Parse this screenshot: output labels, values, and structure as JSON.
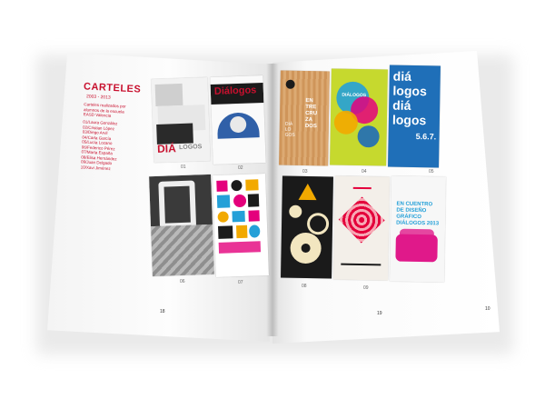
{
  "spread": {
    "left": {
      "title": "CARTELES",
      "years": "2003 - 2013",
      "description": [
        "Carteles realizados por",
        "alumnos de la escuela",
        "EASD Valencia"
      ],
      "credits": [
        "01/Laura González",
        "02/Cristian López",
        "03/Diego Arvil",
        "04/Carla García",
        "05/Lucía Lozano",
        "06/Federico Pérez",
        "07/Marta España",
        "08/Elisa Hernández",
        "09/Juan Delgado",
        "10/Xavi Jiménez"
      ],
      "page_number": "18",
      "captions": [
        "01",
        "02",
        "06",
        "07"
      ]
    },
    "right": {
      "page_number": "19",
      "page_number_edge": "10",
      "captions": [
        "03",
        "04",
        "05",
        "08",
        "09"
      ],
      "posters": {
        "p03": {
          "text": [
            "EN",
            "TRE",
            "CRU",
            "ZA",
            "DOS"
          ],
          "side": [
            "DIÁ",
            "LO",
            "GOS"
          ]
        },
        "p04": {
          "lines": [
            "diá",
            "logos",
            "diá",
            "logos"
          ],
          "date": "5.6.7.",
          "badge": "DIÁLOGOS"
        },
        "p09": {
          "lines": [
            "EN CUENTRO",
            "DE DISEÑO",
            "GRÁFICO",
            "DIÁLOGOS 2013"
          ]
        }
      }
    },
    "left_posters": {
      "p01": {
        "text": "DIÁ",
        "sub": "LOGOS"
      },
      "p02": {
        "text": "Diálogos"
      }
    }
  },
  "colors": {
    "accent": "#c8102e",
    "magenta": "#e0198a",
    "blue": "#1e6bb8",
    "lime": "#c6d92e"
  }
}
